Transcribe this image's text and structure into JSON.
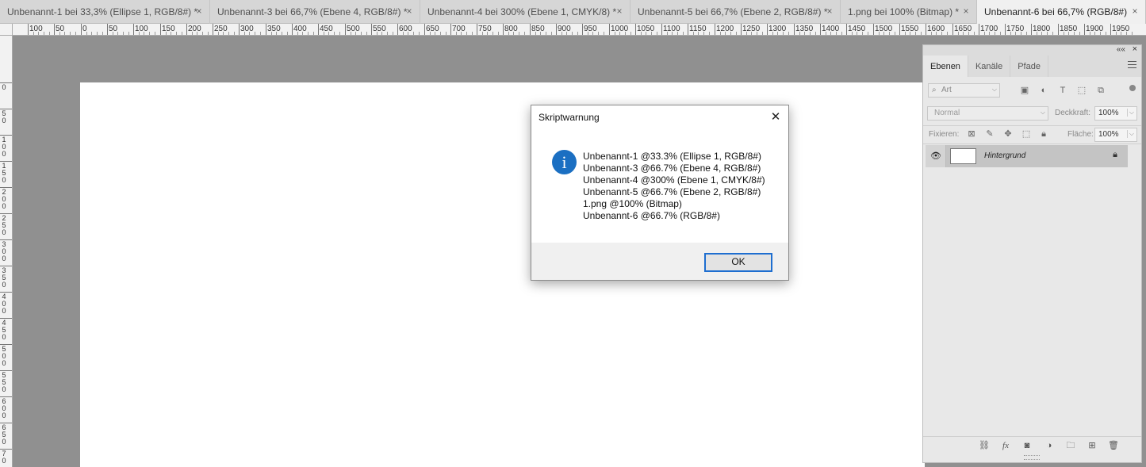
{
  "tabs": [
    {
      "label": "Unbenannt-1 bei 33,3% (Ellipse 1, RGB/8#) *",
      "close": "×",
      "active": false
    },
    {
      "label": "Unbenannt-3 bei 66,7% (Ebene 4, RGB/8#) *",
      "close": "×",
      "active": false
    },
    {
      "label": "Unbenannt-4 bei 300% (Ebene 1, CMYK/8) *",
      "close": "×",
      "active": false
    },
    {
      "label": "Unbenannt-5 bei 66,7% (Ebene 2, RGB/8#) *",
      "close": "×",
      "active": false
    },
    {
      "label": "1.png bei 100% (Bitmap) *",
      "close": "×",
      "active": false
    },
    {
      "label": "Unbenannt-6 bei 66,7% (RGB/8#)",
      "close": "×",
      "active": true
    }
  ],
  "ruler_top_labels": [
    "100",
    "50",
    "0",
    "50",
    "100",
    "150",
    "200",
    "250",
    "300",
    "350",
    "400",
    "450",
    "500",
    "550",
    "600",
    "650",
    "700",
    "750",
    "800",
    "850",
    "900",
    "950",
    "1000",
    "1050",
    "1100",
    "1150",
    "1200",
    "1250",
    "1300",
    "1350",
    "1400",
    "1450",
    "1500",
    "1550",
    "1600",
    "1650",
    "1700",
    "1750",
    "1800",
    "1850",
    "1900",
    "1950"
  ],
  "ruler_left_labels": [
    "0",
    "5 0",
    "1 0 0",
    "1 5 0",
    "2 0 0",
    "2 5 0",
    "3 0 0",
    "3 5 0",
    "4 0 0",
    "4 5 0",
    "5 0 0",
    "5 5 0",
    "6 0 0",
    "6 5 0",
    "7 0"
  ],
  "layers_panel": {
    "tabs": [
      "Ebenen",
      "Kanäle",
      "Pfade"
    ],
    "collapse": "««",
    "close": "×",
    "filter_placeholder": "Art",
    "blend_mode": "Normal",
    "opacity_label": "Deckkraft:",
    "opacity_value": "100%",
    "lock_label": "Fixieren:",
    "fill_label": "Fläche:",
    "fill_value": "100%",
    "layers": [
      {
        "name": "Hintergrund"
      }
    ]
  },
  "dialog": {
    "title": "Skriptwarnung",
    "close": "✕",
    "icon_glyph": "i",
    "lines": [
      "Unbenannt-1 @33.3% (Ellipse 1, RGB/8#)",
      "Unbenannt-3 @66.7% (Ebene 4, RGB/8#)",
      "Unbenannt-4 @300% (Ebene 1, CMYK/8#)",
      "Unbenannt-5 @66.7% (Ebene 2, RGB/8#)",
      "1.png @100% (Bitmap)",
      "Unbenannt-6 @66.7% (RGB/8#)"
    ],
    "ok_label": "OK"
  },
  "colors": {
    "workspace": "#909090",
    "accent_blue": "#1b6fc2",
    "button_focus": "#1e6ed0"
  }
}
